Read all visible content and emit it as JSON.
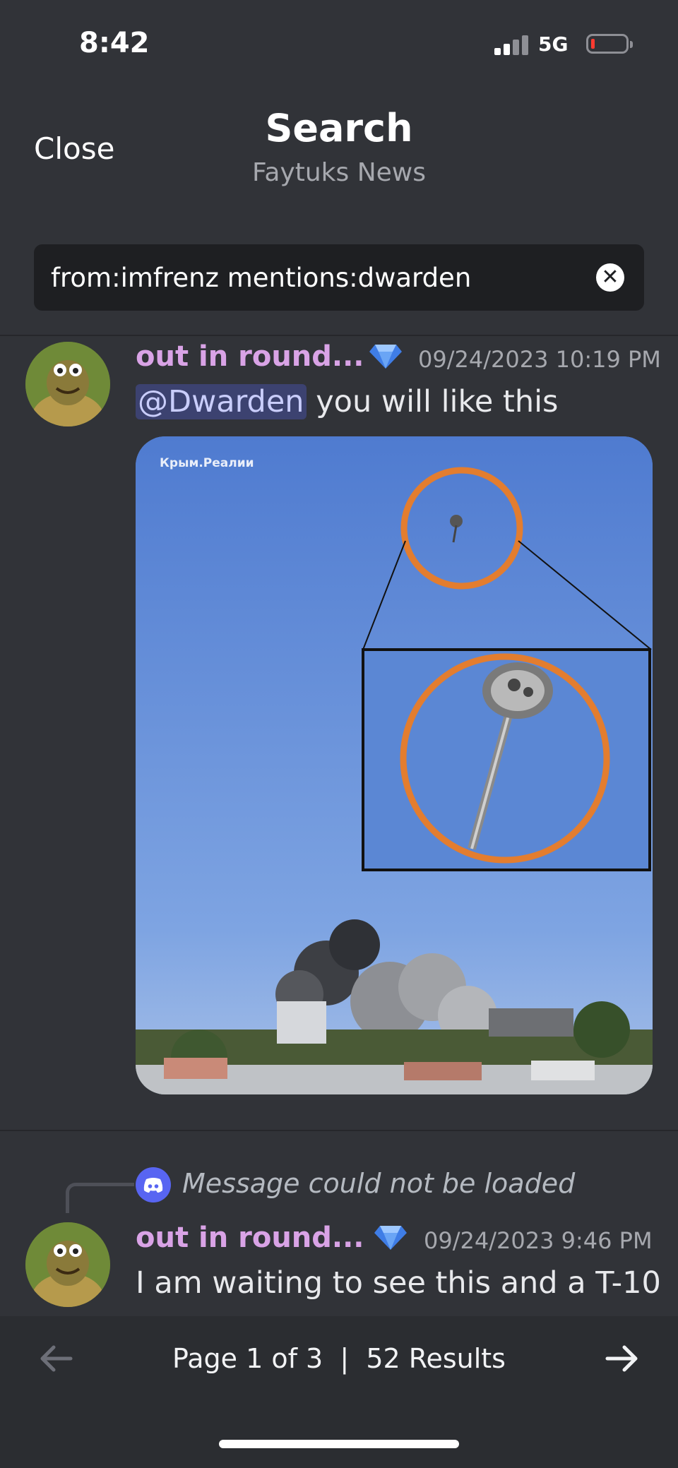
{
  "status_bar": {
    "time": "8:42",
    "network": "5G",
    "battery_color": "#ff3b30"
  },
  "header": {
    "close_label": "Close",
    "title": "Search",
    "subtitle": "Faytuks News"
  },
  "search": {
    "query": "from:imfrenz mentions:dwarden"
  },
  "results": [
    {
      "username": "out in round...",
      "timestamp": "09/24/2023 10:19 PM",
      "mention": "@Dwarden",
      "text": "you will like this",
      "attachment_watermark": "Крым.Реалии"
    },
    {
      "reply_preview": "Message could not be loaded",
      "username": "out in round...",
      "timestamp": "09/24/2023 9:46 PM",
      "text": "I am waiting to see this and a T-10"
    }
  ],
  "pagination": {
    "label": "Page 1 of 3  |  52 Results"
  },
  "colors": {
    "background": "#313338",
    "username": "#d9a3e6",
    "mention_bg": "#3c4270",
    "blurple": "#5865f2"
  }
}
